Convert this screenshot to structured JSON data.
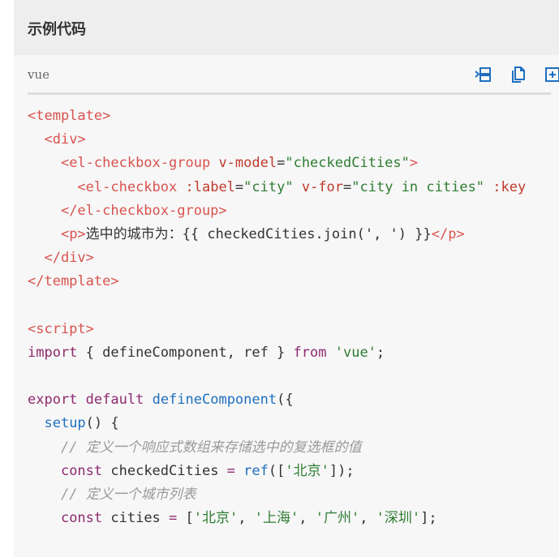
{
  "section": {
    "title": "示例代码"
  },
  "code_block": {
    "language": "vue",
    "toolbar": {
      "icons": [
        "expand-lines-icon",
        "copy-icon",
        "add-icon"
      ]
    },
    "lines": [
      [
        [
          "tag",
          "<template>"
        ]
      ],
      [
        [
          "",
          "  "
        ],
        [
          "tag",
          "<div>"
        ]
      ],
      [
        [
          "",
          "    "
        ],
        [
          "tag",
          "<el-checkbox-group"
        ],
        [
          "",
          " "
        ],
        [
          "attr",
          "v-model"
        ],
        [
          "",
          "="
        ],
        [
          "str",
          "\"checkedCities\""
        ],
        [
          "tag",
          ">"
        ]
      ],
      [
        [
          "",
          "      "
        ],
        [
          "tag",
          "<el-checkbox"
        ],
        [
          "",
          " "
        ],
        [
          "attr",
          ":label"
        ],
        [
          "",
          "="
        ],
        [
          "str",
          "\"city\""
        ],
        [
          "",
          " "
        ],
        [
          "attr",
          "v-for"
        ],
        [
          "",
          "="
        ],
        [
          "str",
          "\"city in cities\""
        ],
        [
          "",
          " "
        ],
        [
          "attr",
          ":key"
        ]
      ],
      [
        [
          "",
          "    "
        ],
        [
          "tag",
          "</el-checkbox-group>"
        ]
      ],
      [
        [
          "",
          "    "
        ],
        [
          "tag",
          "<p>"
        ],
        [
          "",
          "选中的城市为：{{ checkedCities.join(', ') }}"
        ],
        [
          "tag",
          "</p>"
        ]
      ],
      [
        [
          "",
          "  "
        ],
        [
          "tag",
          "</div>"
        ]
      ],
      [
        [
          "tag",
          "</template>"
        ]
      ],
      [
        [
          "",
          ""
        ]
      ],
      [
        [
          "tag",
          "<script>"
        ]
      ],
      [
        [
          "kw",
          "import"
        ],
        [
          "",
          " { defineComponent, ref } "
        ],
        [
          "kw",
          "from"
        ],
        [
          "",
          " "
        ],
        [
          "str",
          "'vue'"
        ],
        [
          "",
          ";"
        ]
      ],
      [
        [
          "",
          ""
        ]
      ],
      [
        [
          "kw",
          "export"
        ],
        [
          "",
          " "
        ],
        [
          "kw",
          "default"
        ],
        [
          "",
          " "
        ],
        [
          "fn",
          "defineComponent"
        ],
        [
          "",
          "({"
        ]
      ],
      [
        [
          "",
          "  "
        ],
        [
          "fn",
          "setup"
        ],
        [
          "",
          "() {"
        ]
      ],
      [
        [
          "",
          "    "
        ],
        [
          "cmt",
          "// 定义一个响应式数组来存储选中的复选框的值"
        ]
      ],
      [
        [
          "",
          "    "
        ],
        [
          "kw",
          "const"
        ],
        [
          "",
          " checkedCities "
        ],
        [
          "kw",
          "="
        ],
        [
          "",
          " "
        ],
        [
          "fn",
          "ref"
        ],
        [
          "",
          "(["
        ],
        [
          "str",
          "'北京'"
        ],
        [
          "",
          "]);"
        ]
      ],
      [
        [
          "",
          "    "
        ],
        [
          "cmt",
          "// 定义一个城市列表"
        ]
      ],
      [
        [
          "",
          "    "
        ],
        [
          "kw",
          "const"
        ],
        [
          "",
          " cities "
        ],
        [
          "kw",
          "="
        ],
        [
          "",
          " ["
        ],
        [
          "str",
          "'北京'"
        ],
        [
          "",
          ", "
        ],
        [
          "str",
          "'上海'"
        ],
        [
          "",
          ", "
        ],
        [
          "str",
          "'广州'"
        ],
        [
          "",
          ", "
        ],
        [
          "str",
          "'深圳'"
        ],
        [
          "",
          "];"
        ]
      ]
    ]
  }
}
